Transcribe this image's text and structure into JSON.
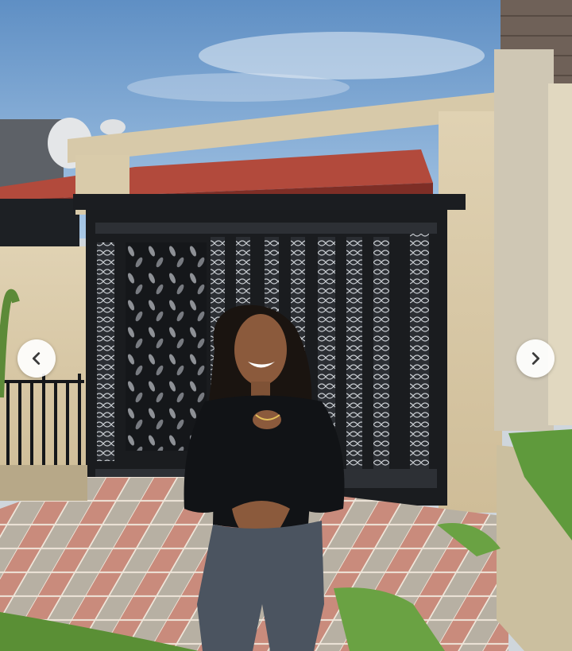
{
  "viewer": {
    "prev_icon": "chevron-left-icon",
    "next_icon": "chevron-right-icon",
    "button_color": "#ffffff",
    "chevron_color": "#3a3a3a"
  },
  "photo": {
    "sky_color": "#6f9fd0",
    "wall_color": "#d8c8a8",
    "gate_color": "#1a1c1f",
    "roof_color": "#b24a3c",
    "grass_color": "#5f9a3c"
  }
}
